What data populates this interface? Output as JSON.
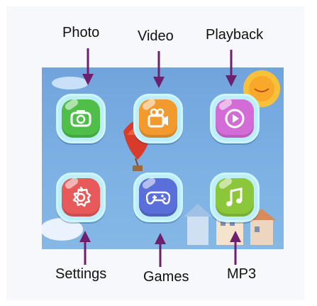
{
  "labels": {
    "photo": "Photo",
    "video": "Video",
    "playback": "Playback",
    "settings": "Settings",
    "games": "Games",
    "mp3": "MP3"
  },
  "apps": [
    {
      "id": "camera",
      "icon": "camera-icon",
      "color": "#4fbf4a"
    },
    {
      "id": "video",
      "icon": "video-camera-icon",
      "color": "#f39a2e"
    },
    {
      "id": "playback",
      "icon": "play-icon",
      "color": "#d46cd8"
    },
    {
      "id": "settings",
      "icon": "gear-icon",
      "color": "#e85a5a"
    },
    {
      "id": "games",
      "icon": "gamepad-icon",
      "color": "#5a6fd9"
    },
    {
      "id": "mp3",
      "icon": "music-note-icon",
      "color": "#8cc63a"
    }
  ],
  "colors": {
    "arrow": "#6e1f6e",
    "screen_bg": "#7db1e4",
    "tile_border": "#bdeefa"
  }
}
